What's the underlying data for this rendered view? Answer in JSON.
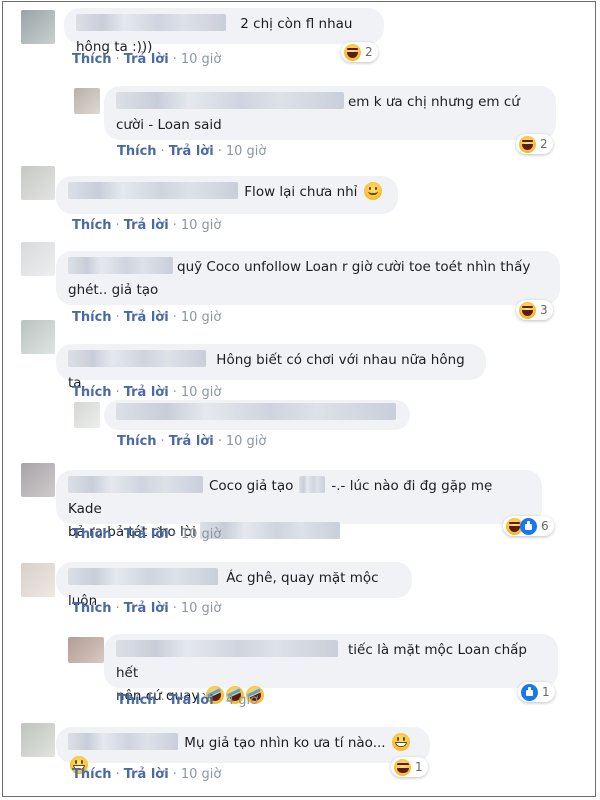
{
  "labels": {
    "like": "Thích",
    "reply": "Trả lời",
    "separator": "·"
  },
  "colors": {
    "bubble": "#f0f2f5",
    "action_link": "#4a6aa5",
    "meta": "#8c96a4",
    "like_blue": "#1877f2",
    "haha_yellow": "#f7b928"
  },
  "comments": [
    {
      "text": "2 chị còn fl nhau hông ta :)))",
      "time": "10 giờ",
      "reactions": [
        "haha"
      ],
      "reaction_count": "2"
    },
    {
      "text_line1": "em k ưa chị nhưng em cứ",
      "text_line2": "cười - Loan said",
      "time": "10 giờ",
      "reactions": [
        "haha"
      ],
      "reaction_count": "2"
    },
    {
      "text": "Flow lại chưa nhỉ",
      "inline_icon": "smiling-face-icon",
      "time": "10 giờ"
    },
    {
      "text_line1": "quỹ Coco unfollow Loan r giờ cười toe toét nhìn thấy",
      "text_line2": "ghét.. giả tạo",
      "time": "10 giờ",
      "reactions": [
        "haha"
      ],
      "reaction_count": "3"
    },
    {
      "text": "Hông biết có chơi với nhau nữa hông ta",
      "time": "10 giờ"
    },
    {
      "text": "",
      "time": "10 giờ"
    },
    {
      "text_line1": "Coco giả tạo",
      "text_line1b": "-.- lúc nào đi đg gặp mẹ Kade",
      "text_line2": "bả ra bả tát cho lòi",
      "time": "10 giờ",
      "reactions": [
        "haha",
        "like"
      ],
      "reaction_count": "6"
    },
    {
      "text": "Ác ghê, quay mặt mộc luôn",
      "time": "10 giờ"
    },
    {
      "text_line1": "tiếc là mặt mộc Loan chấp hết",
      "text_line2": "nên cứ quay",
      "inline_icons": [
        "rolling-laughing-icon",
        "rolling-laughing-icon",
        "rolling-laughing-icon"
      ],
      "time": "4 giờ",
      "reactions": [
        "like"
      ],
      "reaction_count": "1"
    },
    {
      "text": "Mụ giả tạo nhìn ko ưa tí nào...",
      "inline_icons": [
        "grinning-face-icon",
        "grinning-face-icon"
      ],
      "time": "10 giờ",
      "reactions": [
        "haha"
      ],
      "reaction_count": "1"
    }
  ]
}
